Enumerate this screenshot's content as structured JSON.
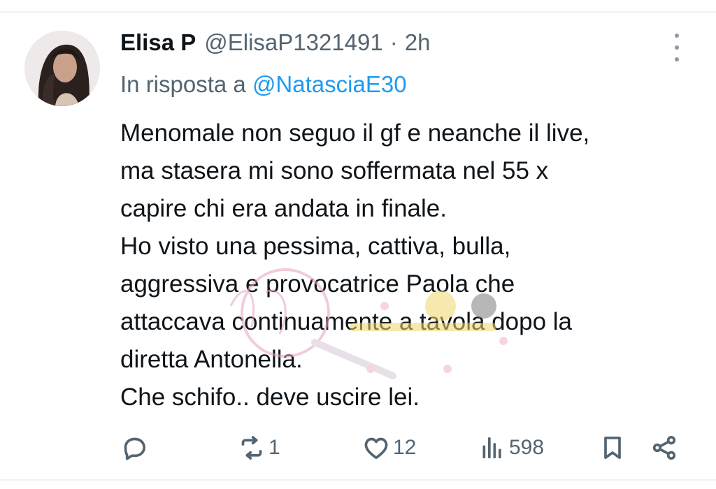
{
  "tweet": {
    "author_name": "Elisa P",
    "handle": "@ElisaP1321491",
    "separator": "·",
    "time": "2h",
    "reply_prefix": "In risposta a",
    "reply_to": "@NatasciaE30",
    "text": "Menomale non seguo il gf  e neanche il live,\nma stasera mi sono soffermata nel 55 x\ncapire chi era andata in finale.\nHo visto una pessima, cattiva, bulla,\naggressiva e provocatrice Paola che\nattaccava continuamente a tavola dopo la\ndiretta Antonella.\nChe schifo.. deve uscire lei."
  },
  "actions": {
    "reply": {
      "icon": "comment-icon",
      "count": ""
    },
    "retweet": {
      "icon": "retweet-icon",
      "count": "1"
    },
    "like": {
      "icon": "heart-icon",
      "count": "12"
    },
    "views": {
      "icon": "views-chart-icon",
      "count": "598"
    },
    "bookmark": {
      "icon": "bookmark-icon",
      "count": ""
    },
    "share": {
      "icon": "share-icon",
      "count": ""
    }
  },
  "colors": {
    "text": "#0f1419",
    "secondary": "#536471",
    "link": "#1d9bf0",
    "divider": "#eff3f4"
  }
}
